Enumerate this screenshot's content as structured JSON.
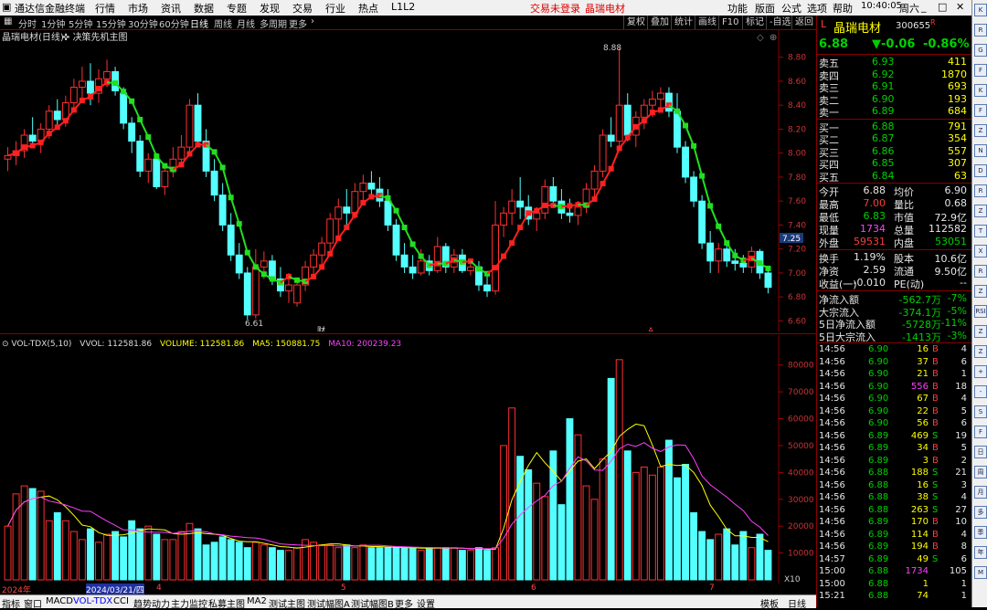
{
  "titlebar": {
    "app_name": "通达信金融终端",
    "menu": [
      "行情",
      "市场",
      "资讯",
      "数据",
      "专题",
      "发现",
      "交易",
      "行业",
      "热点",
      "L1L2"
    ],
    "trade_status": "交易未登录",
    "stock_name": "晶瑞电材",
    "right_menu": [
      "功能",
      "版面",
      "公式",
      "选项",
      "帮助"
    ],
    "time": "10:40:05",
    "weekday": "周六"
  },
  "period_tabs": [
    "分时",
    "1分钟",
    "5分钟",
    "15分钟",
    "30分钟",
    "60分钟",
    "日线",
    "周线",
    "月线",
    "多周期",
    "更多"
  ],
  "active_period": "日线",
  "toolbar_right": [
    "复权",
    "叠加",
    "统计",
    "画线",
    "F10",
    "标记",
    "-自选",
    "返回"
  ],
  "main_chart": {
    "title": "晶瑞电材(日线)",
    "indicator": "决策先机主图",
    "price_ticks": [
      "8.80",
      "8.60",
      "8.40",
      "8.20",
      "8.00",
      "7.80",
      "7.60",
      "7.40",
      "7.20",
      "7.00",
      "6.80",
      "6.60"
    ],
    "current_price_tag": "7.25",
    "high_label": "8.88",
    "low_label": "6.61",
    "marker_cai": "财",
    "marker_a": "A"
  },
  "vol_chart": {
    "legend_name": "VOL-TDX(5,10)",
    "vvol": "VVOL: 112581.86",
    "volume": "VOLUME: 112581.86",
    "ma5": "MA5: 150881.75",
    "ma10": "MA10: 200239.23",
    "ticks": [
      "80000",
      "70000",
      "60000",
      "50000",
      "40000",
      "30000",
      "20000",
      "10000"
    ],
    "unit": "X10"
  },
  "dates": [
    "2024年",
    "2024/03/21/四",
    "4",
    "5",
    "6",
    "7"
  ],
  "bottom_tabs": [
    "指标",
    "窗口",
    "MACD",
    "VOL-TDX",
    "CCI",
    "趋势动力",
    "主力监控",
    "私募主图",
    "MA2",
    "测试主图",
    "测试幅图A",
    "测试幅图B",
    "更多",
    "设置"
  ],
  "bottom_right": [
    "模板",
    "日线"
  ],
  "quote": {
    "prefix": "L",
    "name": "晶瑞电材",
    "code": "300655",
    "flag": "R",
    "price": "6.88",
    "change": "▼-0.06",
    "change_pct": "-0.86%",
    "sells": [
      {
        "label": "卖五",
        "price": "6.93",
        "vol": "411"
      },
      {
        "label": "卖四",
        "price": "6.92",
        "vol": "1870"
      },
      {
        "label": "卖三",
        "price": "6.91",
        "vol": "693"
      },
      {
        "label": "卖二",
        "price": "6.90",
        "vol": "193"
      },
      {
        "label": "卖一",
        "price": "6.89",
        "vol": "684"
      }
    ],
    "buys": [
      {
        "label": "买一",
        "price": "6.88",
        "vol": "791"
      },
      {
        "label": "买二",
        "price": "6.87",
        "vol": "354"
      },
      {
        "label": "买三",
        "price": "6.86",
        "vol": "557"
      },
      {
        "label": "买四",
        "price": "6.85",
        "vol": "307"
      },
      {
        "label": "买五",
        "price": "6.84",
        "vol": "63"
      }
    ],
    "stats": [
      {
        "l1": "今开",
        "v1": "6.88",
        "c1": "wht",
        "l2": "均价",
        "v2": "6.90",
        "c2": "wht"
      },
      {
        "l1": "最高",
        "v1": "7.00",
        "c1": "red",
        "l2": "量比",
        "v2": "0.68",
        "c2": "wht"
      },
      {
        "l1": "最低",
        "v1": "6.83",
        "c1": "grn",
        "l2": "市值",
        "v2": "72.9亿",
        "c2": "wht"
      },
      {
        "l1": "现量",
        "v1": "1734",
        "c1": "mag",
        "l2": "总量",
        "v2": "112582",
        "c2": "wht"
      },
      {
        "l1": "外盘",
        "v1": "59531",
        "c1": "red",
        "l2": "内盘",
        "v2": "53051",
        "c2": "grn"
      }
    ],
    "stats2": [
      {
        "l1": "换手",
        "v1": "1.19%",
        "l2": "股本",
        "v2": "10.6亿"
      },
      {
        "l1": "净资",
        "v1": "2.59",
        "l2": "流通",
        "v2": "9.50亿"
      },
      {
        "l1": "收益(一)",
        "v1": "-0.010",
        "l2": "PE(动)",
        "v2": "--"
      }
    ],
    "flows": [
      {
        "label": "净流入额",
        "val": "-562.7万",
        "pct": "-7%"
      },
      {
        "label": "大宗流入",
        "val": "-374.1万",
        "pct": "-5%"
      },
      {
        "label": "5日净流入额",
        "val": "-5728万",
        "pct": "-11%"
      },
      {
        "label": "5日大宗流入",
        "val": "-1413万",
        "pct": "-3%"
      }
    ],
    "ticks": [
      {
        "t": "14:56",
        "p": "6.90",
        "v": "16",
        "d": "B",
        "n": "4"
      },
      {
        "t": "14:56",
        "p": "6.90",
        "v": "37",
        "d": "B",
        "n": "6"
      },
      {
        "t": "14:56",
        "p": "6.90",
        "v": "21",
        "d": "B",
        "n": "1"
      },
      {
        "t": "14:56",
        "p": "6.90",
        "v": "556",
        "d": "B",
        "n": "18"
      },
      {
        "t": "14:56",
        "p": "6.90",
        "v": "67",
        "d": "B",
        "n": "4"
      },
      {
        "t": "14:56",
        "p": "6.90",
        "v": "22",
        "d": "B",
        "n": "5"
      },
      {
        "t": "14:56",
        "p": "6.90",
        "v": "56",
        "d": "B",
        "n": "6"
      },
      {
        "t": "14:56",
        "p": "6.89",
        "v": "469",
        "d": "S",
        "n": "19"
      },
      {
        "t": "14:56",
        "p": "6.89",
        "v": "34",
        "d": "B",
        "n": "5"
      },
      {
        "t": "14:56",
        "p": "6.89",
        "v": "3",
        "d": "B",
        "n": "2"
      },
      {
        "t": "14:56",
        "p": "6.88",
        "v": "188",
        "d": "S",
        "n": "21"
      },
      {
        "t": "14:56",
        "p": "6.88",
        "v": "16",
        "d": "S",
        "n": "3"
      },
      {
        "t": "14:56",
        "p": "6.88",
        "v": "38",
        "d": "S",
        "n": "4"
      },
      {
        "t": "14:56",
        "p": "6.88",
        "v": "263",
        "d": "S",
        "n": "27"
      },
      {
        "t": "14:56",
        "p": "6.89",
        "v": "170",
        "d": "B",
        "n": "10"
      },
      {
        "t": "14:56",
        "p": "6.89",
        "v": "114",
        "d": "B",
        "n": "4"
      },
      {
        "t": "14:56",
        "p": "6.89",
        "v": "194",
        "d": "B",
        "n": "8"
      },
      {
        "t": "14:57",
        "p": "6.89",
        "v": "49",
        "d": "S",
        "n": "6"
      },
      {
        "t": "15:00",
        "p": "6.88",
        "v": "1734",
        "d": "",
        "n": "105"
      },
      {
        "t": "15:00",
        "p": "6.88",
        "v": "1",
        "d": "",
        "n": "1"
      },
      {
        "t": "15:21",
        "p": "6.88",
        "v": "74",
        "d": "",
        "n": "1"
      }
    ]
  },
  "side_icons": [
    "K",
    "R",
    "G",
    "F",
    "K",
    "F",
    "Z",
    "N",
    "D",
    "R",
    "Z",
    "T",
    "X",
    "R",
    "Z",
    "RSI",
    "Z",
    "Z",
    "+",
    "-",
    "S",
    "F",
    "日",
    "周",
    "月",
    "多",
    "季",
    "年",
    "M"
  ],
  "chart_data": {
    "type": "candlestick",
    "candles": [
      [
        7.95,
        8.05,
        7.85,
        7.98
      ],
      [
        7.98,
        8.1,
        7.9,
        8.02
      ],
      [
        8.02,
        8.2,
        7.96,
        8.15
      ],
      [
        8.15,
        8.3,
        8.05,
        8.1
      ],
      [
        8.1,
        8.25,
        8.0,
        8.2
      ],
      [
        8.2,
        8.4,
        8.12,
        8.35
      ],
      [
        8.35,
        8.45,
        8.2,
        8.28
      ],
      [
        8.28,
        8.48,
        8.22,
        8.42
      ],
      [
        8.42,
        8.62,
        8.35,
        8.55
      ],
      [
        8.55,
        8.72,
        8.45,
        8.6
      ],
      [
        8.6,
        8.75,
        8.4,
        8.5
      ],
      [
        8.5,
        8.7,
        8.42,
        8.62
      ],
      [
        8.62,
        8.78,
        8.55,
        8.68
      ],
      [
        8.68,
        8.72,
        8.48,
        8.52
      ],
      [
        8.5,
        8.55,
        8.2,
        8.25
      ],
      [
        8.25,
        8.3,
        8.0,
        8.1
      ],
      [
        8.1,
        8.15,
        7.8,
        7.85
      ],
      [
        7.85,
        8.0,
        7.75,
        7.95
      ],
      [
        7.95,
        8.0,
        7.7,
        7.72
      ],
      [
        7.72,
        7.9,
        7.65,
        7.85
      ],
      [
        7.85,
        8.05,
        7.8,
        7.95
      ],
      [
        7.95,
        8.15,
        7.9,
        8.05
      ],
      [
        8.05,
        8.45,
        8.0,
        8.4
      ],
      [
        8.4,
        8.5,
        8.05,
        8.1
      ],
      [
        8.1,
        8.2,
        7.8,
        7.85
      ],
      [
        7.85,
        7.95,
        7.6,
        7.65
      ],
      [
        7.65,
        7.75,
        7.35,
        7.4
      ],
      [
        7.4,
        7.5,
        7.1,
        7.15
      ],
      [
        7.15,
        7.25,
        6.95,
        7.0
      ],
      [
        7.0,
        7.05,
        6.61,
        6.65
      ],
      [
        6.65,
        7.2,
        6.62,
        7.05
      ],
      [
        7.05,
        7.18,
        6.95,
        7.1
      ],
      [
        7.1,
        7.15,
        6.9,
        6.95
      ],
      [
        6.95,
        7.05,
        6.8,
        6.85
      ],
      [
        6.85,
        7.0,
        6.75,
        6.9
      ],
      [
        6.75,
        6.95,
        6.72,
        6.9
      ],
      [
        6.9,
        7.1,
        6.85,
        7.05
      ],
      [
        7.05,
        7.2,
        6.95,
        7.15
      ],
      [
        7.15,
        7.3,
        7.05,
        7.25
      ],
      [
        7.25,
        7.5,
        7.15,
        7.45
      ],
      [
        7.45,
        7.62,
        7.3,
        7.55
      ],
      [
        7.55,
        7.7,
        7.4,
        7.5
      ],
      [
        7.5,
        7.75,
        7.45,
        7.68
      ],
      [
        7.68,
        7.82,
        7.6,
        7.75
      ],
      [
        7.75,
        7.85,
        7.65,
        7.7
      ],
      [
        7.7,
        7.8,
        7.55,
        7.6
      ],
      [
        7.6,
        7.7,
        7.35,
        7.4
      ],
      [
        7.4,
        7.45,
        7.1,
        7.15
      ],
      [
        7.15,
        7.25,
        7.0,
        7.05
      ],
      [
        7.05,
        7.15,
        6.95,
        7.0
      ],
      [
        7.0,
        7.2,
        6.98,
        7.1
      ],
      [
        7.1,
        7.15,
        6.98,
        7.02
      ],
      [
        7.02,
        7.3,
        7.0,
        7.22
      ],
      [
        7.22,
        7.25,
        7.0,
        7.05
      ],
      [
        7.05,
        7.2,
        7.0,
        7.15
      ],
      [
        7.15,
        7.2,
        7.0,
        7.02
      ],
      [
        7.02,
        7.1,
        6.98,
        7.05
      ],
      [
        7.05,
        7.1,
        6.85,
        6.9
      ],
      [
        6.9,
        7.0,
        6.8,
        6.85
      ],
      [
        6.85,
        7.6,
        6.82,
        7.4
      ],
      [
        7.4,
        7.55,
        7.3,
        7.5
      ],
      [
        7.5,
        7.7,
        7.4,
        7.6
      ],
      [
        7.6,
        7.8,
        7.45,
        7.55
      ],
      [
        7.55,
        7.65,
        7.4,
        7.45
      ],
      [
        7.45,
        7.55,
        7.35,
        7.5
      ],
      [
        7.5,
        7.78,
        7.45,
        7.72
      ],
      [
        7.72,
        7.8,
        7.55,
        7.6
      ],
      [
        7.6,
        7.7,
        7.45,
        7.5
      ],
      [
        7.5,
        7.62,
        7.42,
        7.48
      ],
      [
        7.48,
        7.6,
        7.4,
        7.55
      ],
      [
        7.55,
        7.75,
        7.5,
        7.7
      ],
      [
        7.7,
        7.9,
        7.62,
        7.85
      ],
      [
        7.85,
        8.2,
        7.8,
        8.15
      ],
      [
        8.15,
        8.3,
        8.05,
        8.1
      ],
      [
        8.1,
        8.88,
        8.05,
        8.4
      ],
      [
        8.4,
        8.5,
        8.1,
        8.15
      ],
      [
        8.15,
        8.35,
        8.05,
        8.3
      ],
      [
        8.3,
        8.45,
        8.2,
        8.4
      ],
      [
        8.4,
        8.52,
        8.3,
        8.45
      ],
      [
        8.45,
        8.55,
        8.35,
        8.5
      ],
      [
        8.5,
        8.55,
        8.3,
        8.35
      ],
      [
        8.35,
        8.5,
        8.0,
        8.05
      ],
      [
        8.05,
        8.1,
        7.75,
        7.8
      ],
      [
        7.8,
        7.85,
        7.55,
        7.6
      ],
      [
        7.6,
        7.65,
        7.2,
        7.25
      ],
      [
        7.25,
        7.35,
        7.0,
        7.1
      ],
      [
        7.1,
        7.25,
        7.0,
        7.2
      ],
      [
        7.2,
        7.25,
        7.05,
        7.1
      ],
      [
        7.1,
        7.2,
        7.02,
        7.08
      ],
      [
        7.08,
        7.15,
        7.0,
        7.05
      ],
      [
        7.05,
        7.22,
        7.0,
        7.18
      ],
      [
        7.18,
        7.2,
        6.95,
        7.0
      ],
      [
        7.0,
        7.05,
        6.83,
        6.88
      ]
    ],
    "volumes": [
      20000,
      32000,
      35000,
      34000,
      33000,
      22000,
      25000,
      22000,
      18000,
      15000,
      19000,
      14000,
      17000,
      18000,
      16000,
      22000,
      19000,
      20000,
      17000,
      15000,
      15000,
      18000,
      21000,
      19000,
      13000,
      14000,
      16000,
      15000,
      14000,
      12000,
      14000,
      13000,
      12000,
      11000,
      11000,
      12000,
      15000,
      14000,
      13000,
      13000,
      12000,
      13000,
      12000,
      13000,
      12000,
      12000,
      12000,
      12000,
      12000,
      12000,
      11000,
      12000,
      12000,
      12000,
      12000,
      11000,
      11000,
      12000,
      11000,
      12000,
      50000,
      64000,
      46000,
      41000,
      36000,
      31000,
      48000,
      28000,
      60000,
      54000,
      35000,
      30000,
      45000,
      75000,
      82000,
      48000,
      40000,
      42000,
      39000,
      42000,
      52000,
      38000,
      43000,
      25000,
      18000,
      15000,
      17000,
      19000,
      13000,
      18000,
      12000,
      17000,
      11000
    ],
    "ylim": [
      6.55,
      8.95
    ],
    "vol_ylim": [
      0,
      85000
    ]
  }
}
